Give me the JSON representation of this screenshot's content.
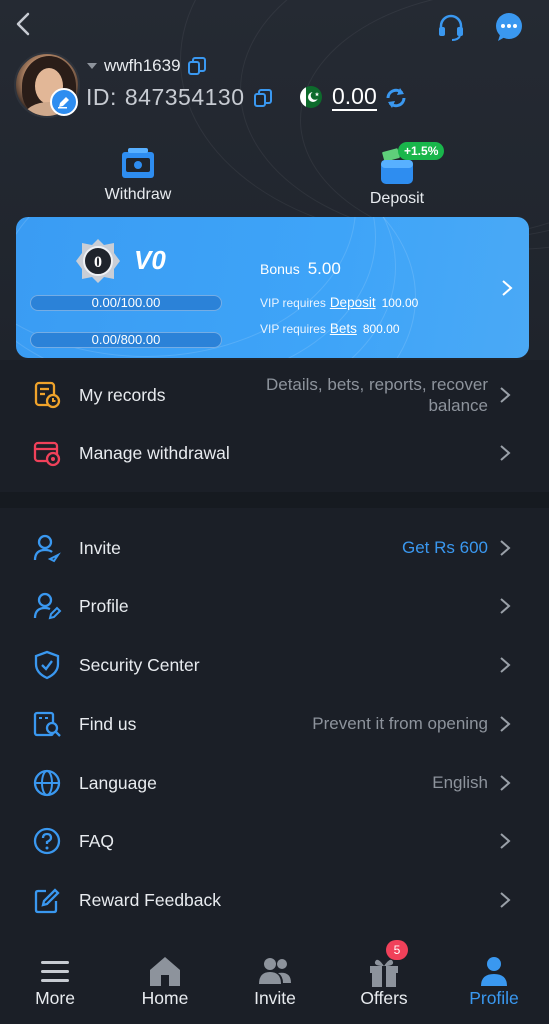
{
  "header": {
    "back_icon": "back-arrow-icon",
    "support_icon": "headset-icon",
    "chat_icon": "chat-bubble-icon"
  },
  "user": {
    "username": "wwfh1639",
    "id_label": "ID:",
    "id_value": "847354130",
    "balance": "0.00",
    "currency_flag": "pakistan-flag-icon"
  },
  "actions": {
    "withdraw_label": "Withdraw",
    "deposit_label": "Deposit",
    "deposit_bonus": "+1.5%"
  },
  "vip": {
    "level": "V0",
    "badge_text": "0",
    "progress_deposit": "0.00/100.00",
    "progress_bets": "0.00/800.00",
    "bonus_label": "Bonus",
    "bonus_value": "5.00",
    "req_prefix": "VIP requires",
    "req_deposit_link": "Deposit",
    "req_deposit_value": "100.00",
    "req_bets_link": "Bets",
    "req_bets_value": "800.00"
  },
  "menu_top": [
    {
      "label": "My records",
      "value": "Details, bets, reports, recover balance"
    },
    {
      "label": "Manage withdrawal",
      "value": ""
    }
  ],
  "menu_main": [
    {
      "label": "Invite",
      "value": "Get Rs 600"
    },
    {
      "label": "Profile",
      "value": ""
    },
    {
      "label": "Security Center",
      "value": ""
    },
    {
      "label": "Find us",
      "value": "Prevent it from opening"
    },
    {
      "label": "Language",
      "value": "English"
    },
    {
      "label": "FAQ",
      "value": ""
    },
    {
      "label": "Reward Feedback",
      "value": ""
    }
  ],
  "tabs": [
    {
      "label": "More"
    },
    {
      "label": "Home"
    },
    {
      "label": "Invite"
    },
    {
      "label": "Offers",
      "badge": "5"
    },
    {
      "label": "Profile"
    }
  ],
  "colors": {
    "accent": "#3a98f0",
    "background": "#1b1f27",
    "vip_card": "#3ea4f8",
    "deposit_badge": "#19b64b",
    "notification_badge": "#f0415a",
    "records_icon": "#f0a32b",
    "withdrawal_icon": "#f0415a"
  }
}
